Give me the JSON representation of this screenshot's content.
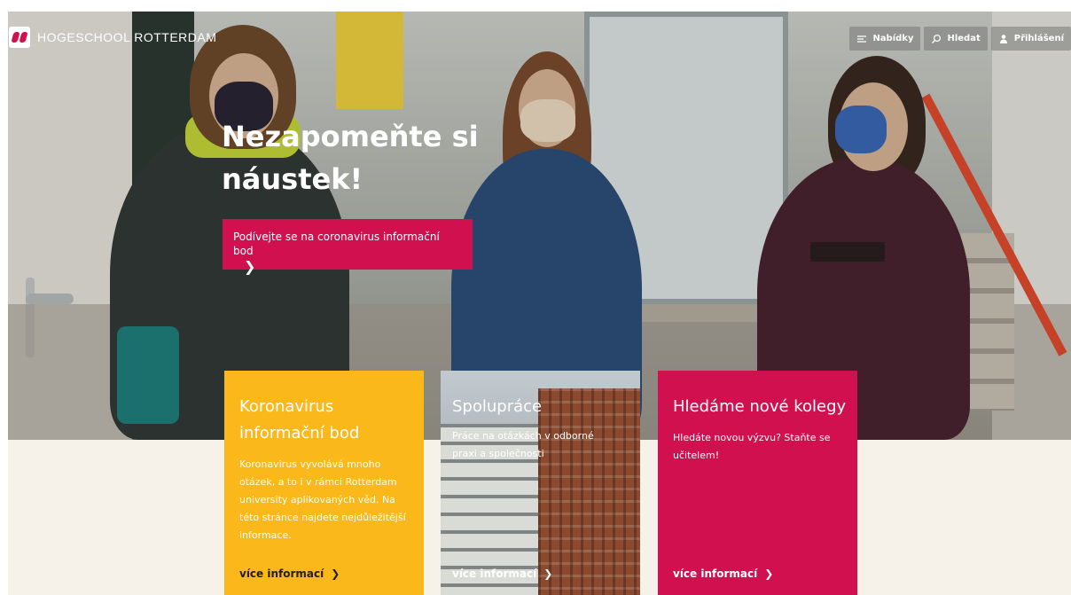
{
  "header": {
    "logo_text": "HOGESCHOOL ROTTERDAM",
    "nav": [
      {
        "label": "Nabídky",
        "icon": "menu-icon"
      },
      {
        "label": "Hledat",
        "icon": "search-icon"
      },
      {
        "label": "Přihlášení",
        "icon": "user-icon"
      }
    ]
  },
  "hero": {
    "title_line1": "Nezapomeňte si",
    "title_line2": "náustek!",
    "cta_label": "Podívejte se na coronavirus informační bod",
    "cta_arrow": "❯"
  },
  "cards": [
    {
      "title": "Koronavirus informační bod",
      "description": "Koronavirus vyvolává mnoho otázek, a to i v rámci Rotterdam university aplikovaných věd. Na této stránce najdete nejdůležitější informace.",
      "more_label": "více informací",
      "more_arrow": "❯",
      "color": "#fbb81a"
    },
    {
      "title": "Spolupráce",
      "description": "Práce na otázkách v odborné praxi a společnosti",
      "more_label": "více informací",
      "more_arrow": "❯"
    },
    {
      "title": "Hledáme nové kolegy",
      "description": "Hledáte novou výzvu? Staňte se učitelem!",
      "more_label": "více informací",
      "more_arrow": "❯",
      "color": "#d1114f"
    }
  ],
  "colors": {
    "brand_red": "#d1114f",
    "accent_yellow": "#fbb81a",
    "beige_background": "#f6f2ea"
  }
}
